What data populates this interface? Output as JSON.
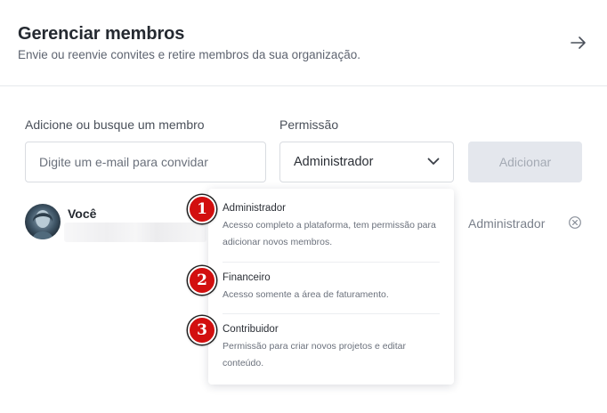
{
  "header": {
    "title": "Gerenciar membros",
    "subtitle": "Envie ou reenvie convites e retire membros da sua organização."
  },
  "form": {
    "email_label": "Adicione ou busque um membro",
    "email_placeholder": "Digite um e-mail para convidar",
    "permission_label": "Permissão",
    "permission_selected": "Administrador",
    "add_button": "Adicionar"
  },
  "members": [
    {
      "name": "Você",
      "role": "Administrador"
    }
  ],
  "dropdown": {
    "options": [
      {
        "title": "Administrador",
        "description": "Acesso completo a plataforma, tem permissão para adicionar novos membros."
      },
      {
        "title": "Financeiro",
        "description": "Acesso somente a área de faturamento."
      },
      {
        "title": "Contribuidor",
        "description": "Permissão para criar novos projetos e editar conteúdo."
      }
    ]
  },
  "markers": [
    "1",
    "2",
    "3"
  ],
  "colors": {
    "marker": "#d20f0f",
    "disabled_button_bg": "#e4e7ed",
    "border": "#d9dce1"
  }
}
